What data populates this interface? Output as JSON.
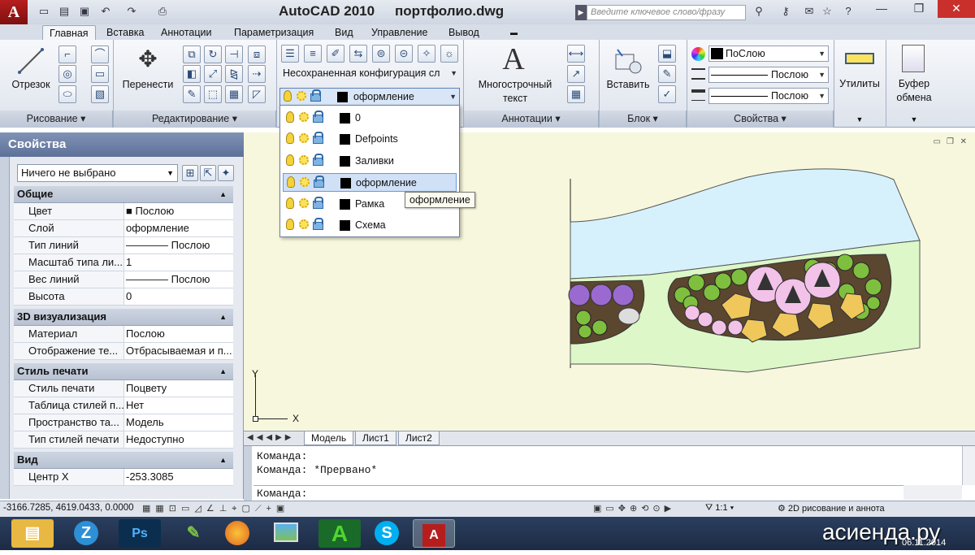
{
  "titlebar": {
    "app_title": "AutoCAD 2010",
    "file_name": "портфолио.dwg",
    "search_placeholder": "Введите ключевое слово/фразу",
    "app_button": "A"
  },
  "tabs": [
    "Главная",
    "Вставка",
    "Аннотации",
    "Параметризация",
    "Вид",
    "Управление",
    "Вывод"
  ],
  "ribbon": {
    "draw": {
      "line_label": "Отрезок",
      "panel": "Рисование"
    },
    "modify": {
      "move_label": "Перенести",
      "panel": "Редактирование"
    },
    "layers": {
      "config_combo": "Несохраненная конфигурация сл",
      "current_layer": "оформление"
    },
    "annotations": {
      "mtext_line1": "Многострочный",
      "mtext_line2": "текст",
      "panel": "Аннотации",
      "mtext_icon": "A"
    },
    "block": {
      "insert_label": "Вставить",
      "panel": "Блок"
    },
    "properties": {
      "color": "ПоСлою",
      "linetype": "Послою",
      "lineweight": "Послою",
      "panel": "Свойства"
    },
    "utilities": {
      "label": "Утилиты"
    },
    "clipboard": {
      "line1": "Буфер",
      "line2": "обмена"
    }
  },
  "layer_dropdown": {
    "items": [
      "0",
      "Defpoints",
      "Заливки",
      "оформление",
      "Рамка",
      "Схема"
    ],
    "selected": "оформление",
    "tooltip": "оформление"
  },
  "properties_palette": {
    "title": "Свойства",
    "selection": "Ничего не выбрано",
    "sections": [
      {
        "title": "Общие",
        "rows": [
          {
            "key": "Цвет",
            "value": "■ Послою"
          },
          {
            "key": "Слой",
            "value": "оформление"
          },
          {
            "key": "Тип линий",
            "value": "———— Послою"
          },
          {
            "key": "Масштаб типа ли...",
            "value": "1"
          },
          {
            "key": "Вес линий",
            "value": "———— Послою"
          },
          {
            "key": "Высота",
            "value": "0"
          }
        ]
      },
      {
        "title": "3D визуализация",
        "rows": [
          {
            "key": "Материал",
            "value": "Послою"
          },
          {
            "key": "Отображение те...",
            "value": "Отбрасываемая и п..."
          }
        ]
      },
      {
        "title": "Стиль печати",
        "rows": [
          {
            "key": "Стиль печати",
            "value": "Поцвету"
          },
          {
            "key": "Таблица стилей п...",
            "value": "Нет"
          },
          {
            "key": "Пространство та...",
            "value": "Модель"
          },
          {
            "key": "Тип стилей печати",
            "value": "Недоступно"
          }
        ]
      },
      {
        "title": "Вид",
        "rows": [
          {
            "key": "Центр X",
            "value": "-253.3085"
          }
        ]
      }
    ]
  },
  "layout_tabs": [
    "Модель",
    "Лист1",
    "Лист2"
  ],
  "ucs": {
    "x": "X",
    "y": "Y"
  },
  "command_line": {
    "lines": [
      "Команда:",
      "Команда: *Прервано*"
    ],
    "prompt": "Команда:"
  },
  "status_bar": {
    "coords": "-3166.7285, 4619.0433, 0.0000",
    "scale": "1:1",
    "workspace": "2D рисование и аннота"
  },
  "taskbar": {
    "watermark": "асиенда.ру",
    "date": "06.11.2014"
  },
  "colors": {
    "water": "#d6f1fb",
    "lawn": "#ddf7c8",
    "bed": "#5b4630",
    "accent_red": "#b61e1e"
  }
}
